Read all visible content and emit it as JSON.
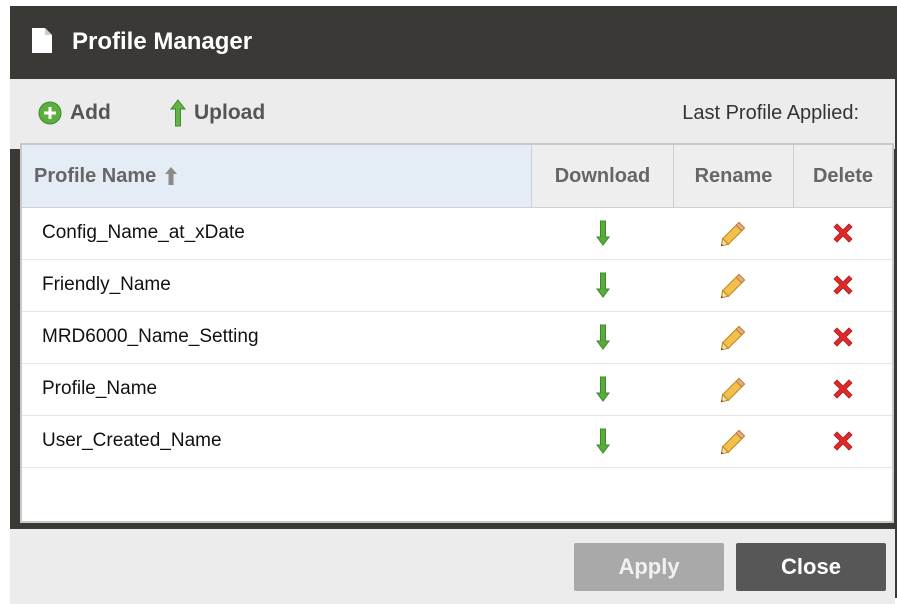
{
  "dialog": {
    "title": "Profile Manager"
  },
  "toolbar": {
    "add_label": "Add",
    "upload_label": "Upload",
    "last_profile_label": "Last Profile Applied:"
  },
  "table": {
    "headers": {
      "name": "Profile Name",
      "download": "Download",
      "rename": "Rename",
      "delete": "Delete"
    },
    "rows": [
      {
        "name": "Config_Name_at_xDate"
      },
      {
        "name": "Friendly_Name"
      },
      {
        "name": "MRD6000_Name_Setting"
      },
      {
        "name": "Profile_Name"
      },
      {
        "name": "User_Created_Name"
      }
    ]
  },
  "footer": {
    "apply_label": "Apply",
    "close_label": "Close"
  },
  "icons": {
    "add": "plus-circle-icon",
    "upload": "arrow-up-icon",
    "sort": "sort-ascending-icon",
    "download": "arrow-down-icon",
    "rename": "pencil-icon",
    "delete": "red-x-icon"
  },
  "colors": {
    "titlebar": "#3a3936",
    "toolbar": "#ececec",
    "header_sorted": "#e4ecf5",
    "delete": "#e0292b",
    "download": "#4a9a32"
  }
}
